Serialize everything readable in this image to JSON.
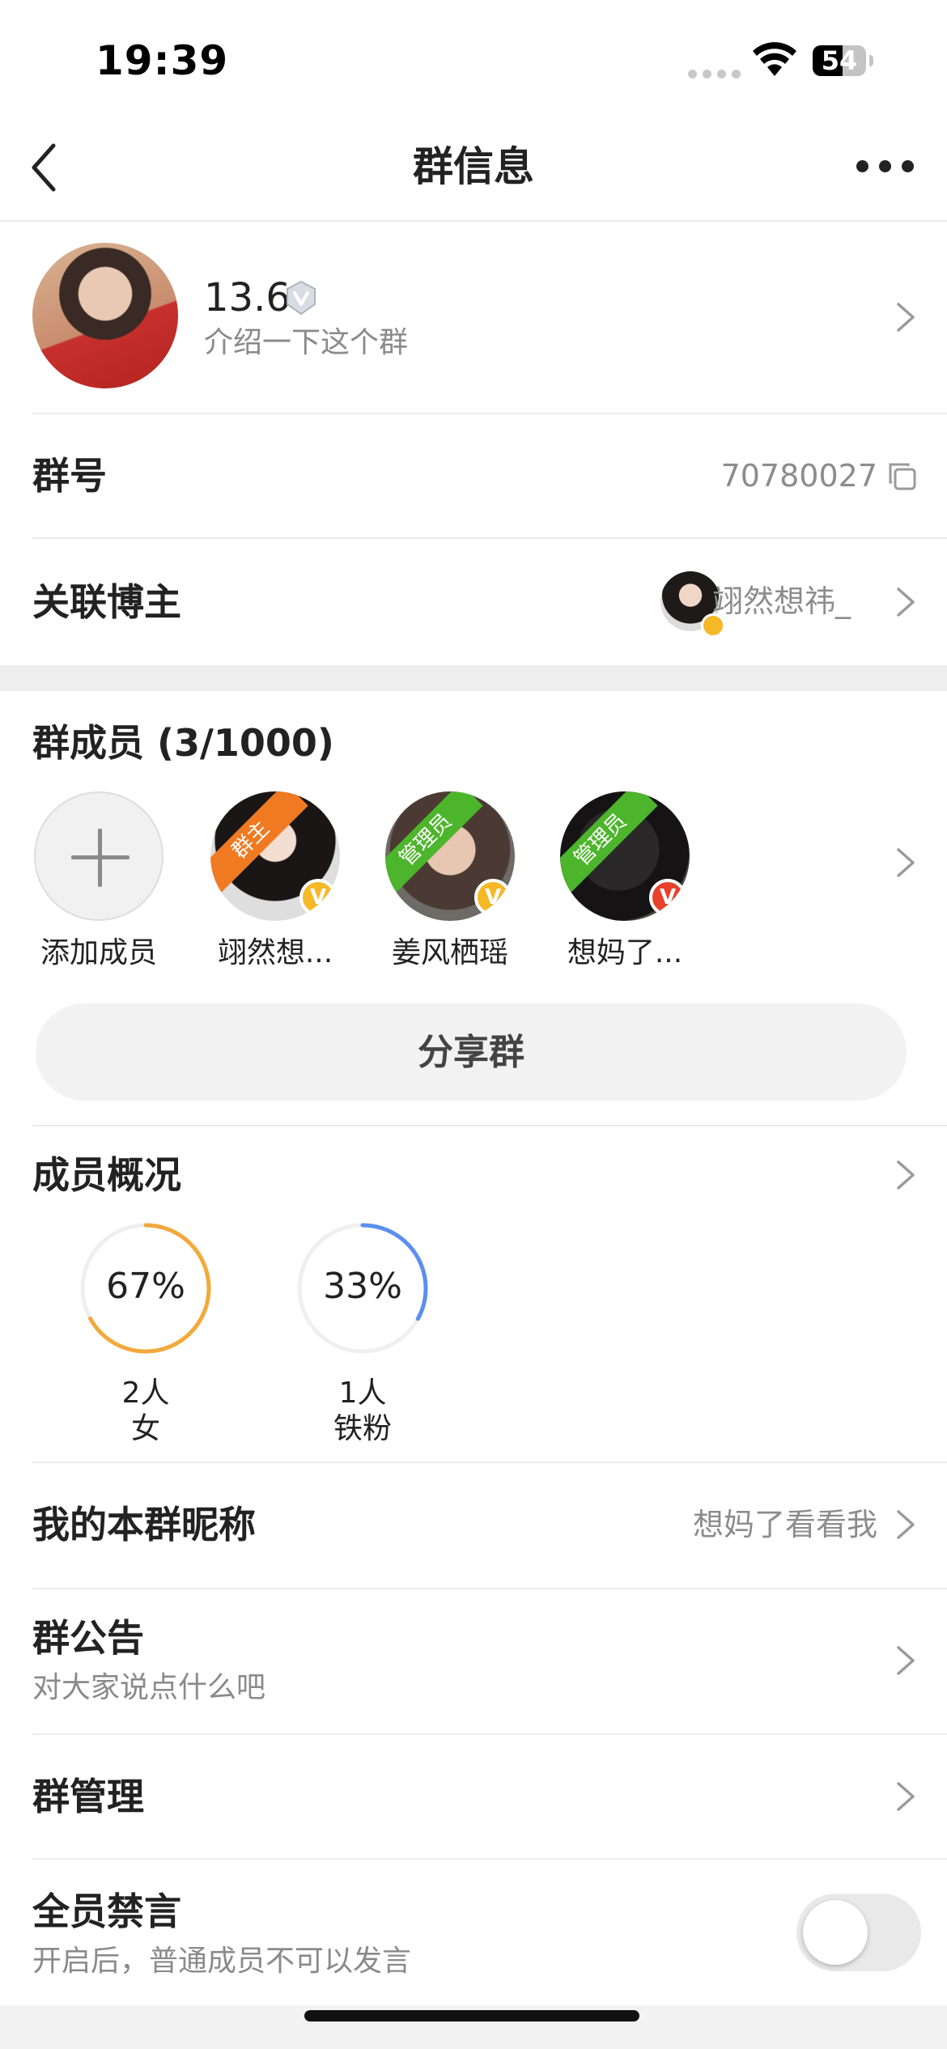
{
  "status_bar": {
    "time": "19:39",
    "battery": "54",
    "battery_level_pct": 56,
    "icons": [
      "cellular-dots-icon",
      "wifi-icon",
      "battery-icon"
    ]
  },
  "nav": {
    "title": "群信息",
    "back_icon": "chevron-left-icon",
    "more_icon": "more-dots-icon"
  },
  "group": {
    "name": "13.6",
    "intro": "介绍一下这个群",
    "verify_icon": "shield-badge-icon"
  },
  "info_rows": {
    "group_id_label": "群号",
    "group_id_value": "70780027",
    "linked_blogger_label": "关联博主",
    "linked_blogger_value": "翊然想祎_"
  },
  "members": {
    "title": "群成员 (3/1000)",
    "add_label": "添加成员",
    "list": [
      {
        "name": "翊然想...",
        "role": "群主",
        "role_color": "#f07a22",
        "badge_color": "#f5b826"
      },
      {
        "name": "姜风栖瑶",
        "role": "管理员",
        "role_color": "#4cb52b",
        "badge_color": "#f5b826"
      },
      {
        "name": "想妈了...",
        "role": "管理员",
        "role_color": "#4cb52b",
        "badge_color": "#e8412b"
      }
    ]
  },
  "share_button": "分享群",
  "overview": {
    "title": "成员概况",
    "stats": [
      {
        "percent_label": "67%",
        "percent": 67,
        "count": "2人",
        "label": "女",
        "color": "#f2a93b"
      },
      {
        "percent_label": "33%",
        "percent": 33,
        "count": "1人",
        "label": "铁粉",
        "color": "#5b8ef0"
      }
    ]
  },
  "nickname_row": {
    "label": "我的本群昵称",
    "value": "想妈了看看我"
  },
  "notice_row": {
    "label": "群公告",
    "sub": "对大家说点什么吧"
  },
  "manage_row": {
    "label": "群管理"
  },
  "mute_row": {
    "label": "全员禁言",
    "sub": "开启后，普通成员不可以发言",
    "enabled": false
  }
}
